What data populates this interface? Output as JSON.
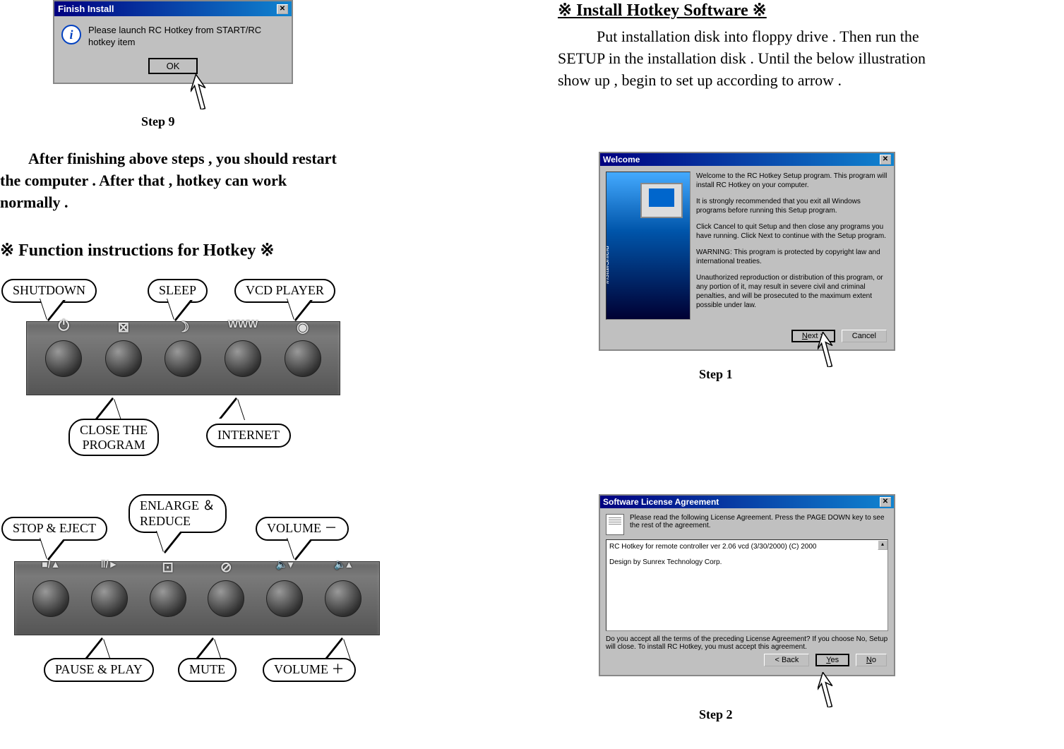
{
  "finish_dialog": {
    "title": "Finish Install",
    "message": "Please launch RC Hotkey from START/RC hotkey item",
    "ok": "OK",
    "info_glyph": "i"
  },
  "step9": "Step 9",
  "restart_text": "After finishing above steps , you should restart the computer . After that , hotkey can work normally .",
  "function_heading": "※  Function instructions for Hotkey  ※",
  "hotkey_top": {
    "shutdown": "SHUTDOWN",
    "sleep": "SLEEP",
    "vcd": "VCD PLAYER",
    "close": "CLOSE THE PROGRAM",
    "internet": "INTERNET",
    "strip_icons": [
      "⏻",
      "⊠",
      "☽",
      "WWW",
      "◉"
    ]
  },
  "hotkey_bottom": {
    "stop": "STOP & EJECT",
    "enlarge": "ENLARGE ＆REDUCE",
    "volminus": "VOLUME －",
    "pause": "PAUSE & PLAY",
    "mute": "MUTE",
    "volplus": "VOLUME ＋",
    "strip_icons": [
      "■/▲",
      "ǁ/►",
      "⊡",
      "⊘",
      "🔈▾",
      "🔈▴"
    ]
  },
  "install": {
    "heading": "※ Install  Hotkey Software ※",
    "text": "Put installation disk into floppy drive . Then run the SETUP in the installation disk . Until the below illustration show up , begin to set up according to arrow ."
  },
  "welcome": {
    "title": "Welcome",
    "p1": "Welcome to the RC Hotkey Setup program.  This program will install RC Hotkey on your computer.",
    "p2": "It is strongly recommended that you exit all Windows programs before running this Setup program.",
    "p3": "Click Cancel to quit Setup and then close any programs you have running.  Click Next to continue with the Setup program.",
    "p4": "WARNING: This program is protected by copyright law and international treaties.",
    "p5": "Unauthorized reproduction or distribution of this program, or any portion of it, may result in severe civil and criminal penalties, and will be prosecuted to the maximum extent possible under law.",
    "next": "Next >",
    "cancel": "Cancel"
  },
  "step1": "Step 1",
  "license": {
    "title": "Software License Agreement",
    "prompt": "Please read the following License Agreement. Press the PAGE DOWN key to see the rest of the agreement.",
    "line1": "RC Hotkey for remote controller ver 2.06 vcd (3/30/2000) (C) 2000",
    "line2": "Design by Sunrex Technology Corp.",
    "question": "Do you accept all the terms of the preceding License Agreement?  If you choose No,  Setup will close.  To install RC Hotkey, you must accept this agreement.",
    "back": "< Back",
    "yes": "Yes",
    "no": "No"
  },
  "step2": "Step 2"
}
